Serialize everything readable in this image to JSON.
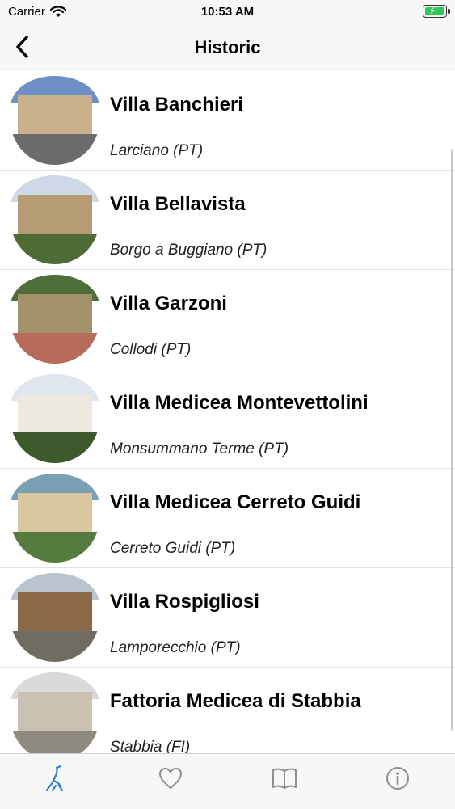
{
  "status_bar": {
    "carrier": "Carrier",
    "time": "10:53 AM"
  },
  "nav": {
    "title": "Historic"
  },
  "items": [
    {
      "title": "Villa Banchieri",
      "location": "Larciano (PT)",
      "thumb": {
        "sky": "#6f8fc7",
        "building": "#c7b08a",
        "ground": "#6b6b6b"
      }
    },
    {
      "title": "Villa Bellavista",
      "location": "Borgo a Buggiano (PT)",
      "thumb": {
        "sky": "#cfd8e6",
        "building": "#b69c74",
        "ground": "#4f6b35"
      }
    },
    {
      "title": "Villa Garzoni",
      "location": "Collodi (PT)",
      "thumb": {
        "sky": "#4e6e3a",
        "building": "#a3916a",
        "ground": "#b66b5b"
      }
    },
    {
      "title": "Villa Medicea Montevettolini",
      "location": "Monsummano Terme (PT)",
      "thumb": {
        "sky": "#dfe6ef",
        "building": "#ece9e1",
        "ground": "#3d5a2d"
      }
    },
    {
      "title": "Villa Medicea Cerreto Guidi",
      "location": "Cerreto Guidi (PT)",
      "thumb": {
        "sky": "#7aa0b6",
        "building": "#d9c7a0",
        "ground": "#567b3e"
      }
    },
    {
      "title": "Villa Rospigliosi",
      "location": "Lamporecchio (PT)",
      "thumb": {
        "sky": "#b9c4cf",
        "building": "#8c6a48",
        "ground": "#6f6d62"
      }
    },
    {
      "title": "Fattoria Medicea di Stabbia",
      "location": "Stabbia (FI)",
      "thumb": {
        "sky": "#d9d9d9",
        "building": "#c9c2b2",
        "ground": "#8e8a7f"
      }
    }
  ],
  "tabs": [
    {
      "icon": "heron-icon",
      "active": true,
      "color": "#2f7fd1"
    },
    {
      "icon": "heart-icon",
      "active": false,
      "color": "#8e8e93"
    },
    {
      "icon": "book-icon",
      "active": false,
      "color": "#8e8e93"
    },
    {
      "icon": "info-icon",
      "active": false,
      "color": "#8e8e93"
    }
  ]
}
